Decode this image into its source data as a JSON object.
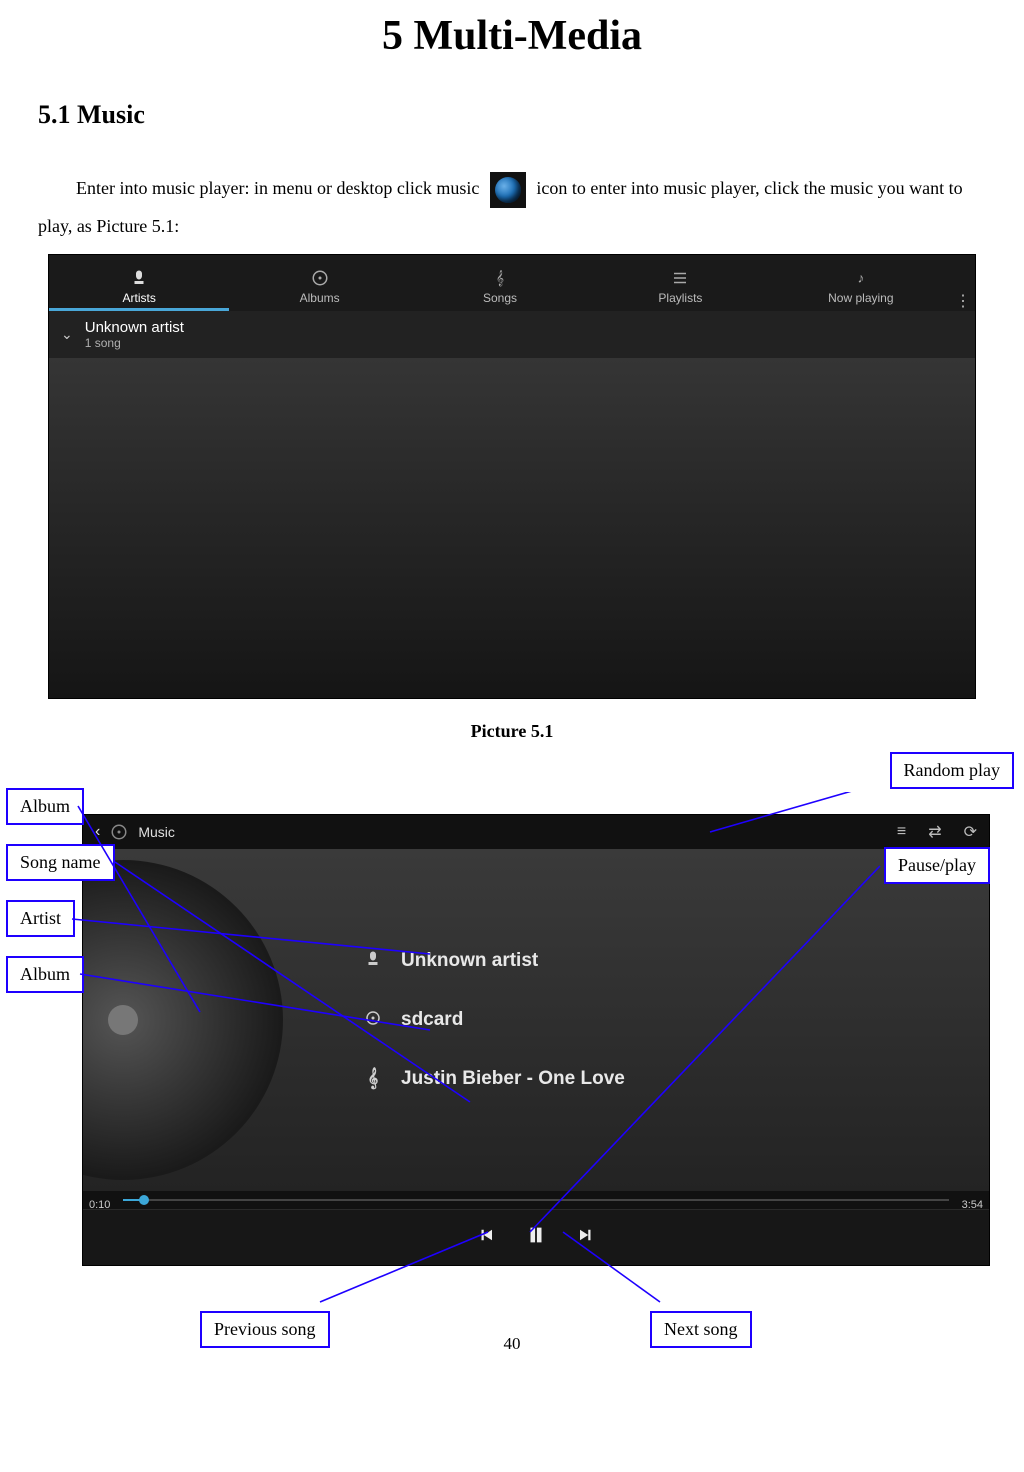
{
  "page_number": "40",
  "chapter_title": "5 Multi-Media",
  "section_title": "5.1 Music",
  "para_pre": "Enter into music player: in menu or desktop click music",
  "para_post": "icon to enter into music player, click the music you want to play, as Picture 5.1:",
  "caption_5_1": "Picture 5.1",
  "fig51": {
    "tabs": [
      "Artists",
      "Albums",
      "Songs",
      "Playlists",
      "Now playing"
    ],
    "active_tab": 0,
    "artist_name": "Unknown artist",
    "artist_sub": "1 song"
  },
  "fig52": {
    "app_title": "Music",
    "artist": "Unknown artist",
    "album": "sdcard",
    "song": "Justin Bieber - One Love",
    "time_elapsed": "0:10",
    "time_total": "3:54"
  },
  "callouts": {
    "album_art": "Album",
    "song_name": "Song name",
    "artist": "Artist",
    "album": "Album",
    "random": "Random play",
    "pause_play": "Pause/play",
    "previous": "Previous song",
    "next": "Next song"
  }
}
